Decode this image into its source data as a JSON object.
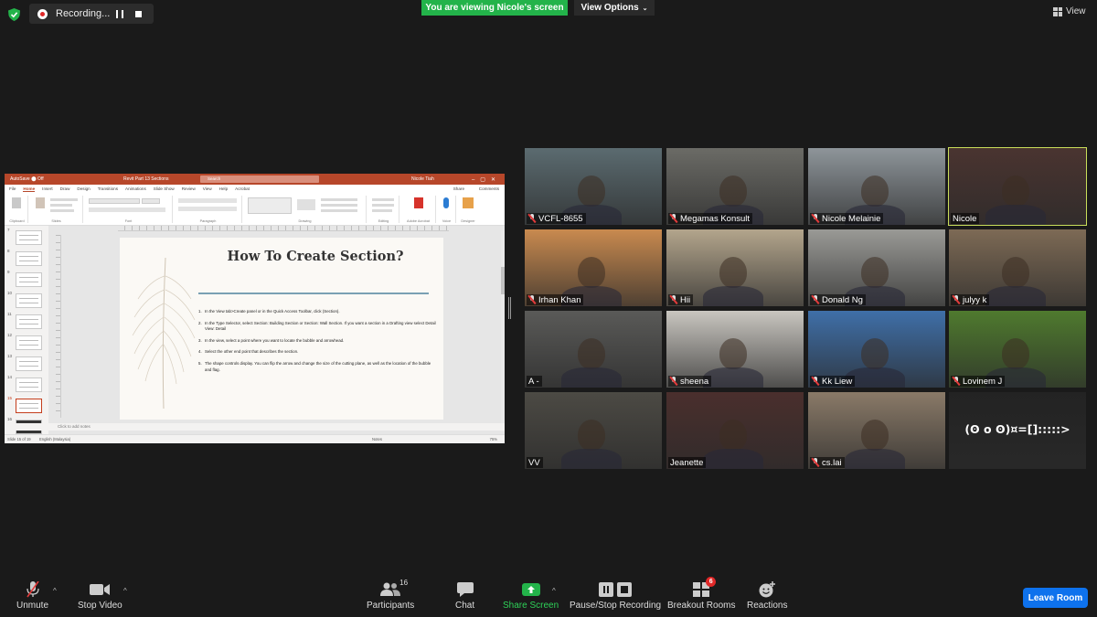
{
  "top_bar": {
    "recording_label": "Recording...",
    "banner_text": "You are viewing Nicole's screen",
    "view_options_label": "View Options",
    "view_label": "View"
  },
  "shared_screen": {
    "ppt": {
      "autosave": "AutoSave ⬤ Off",
      "file_name": "Revit Part 13 Sections",
      "search_placeholder": "Search",
      "user": "Nicole Tiah",
      "tabs": [
        "File",
        "Home",
        "Insert",
        "Draw",
        "Design",
        "Transitions",
        "Animations",
        "Slide Show",
        "Review",
        "View",
        "Help",
        "Acrobat"
      ],
      "share_label": "Share",
      "comments_label": "Comments",
      "ribbon_groups": [
        "Clipboard",
        "Slides",
        "Font",
        "Paragraph",
        "Drawing",
        "Editing",
        "Adobe Acrobat",
        "Voice",
        "Designer"
      ],
      "slide_numbers": [
        "7",
        "8",
        "9",
        "10",
        "11",
        "12",
        "13",
        "14",
        "15",
        "16"
      ],
      "slide_title": "How To Create Section?",
      "slide_items": [
        "In the View tab>Create panel or in the Quick Access Toolbar, click  (Section).",
        "In the Type Selector, select Section: Building Section or Section: Wall Section. If you want a section in a Drafting view select Detail View: Detail",
        "In the view, select a point where you want to locate the bubble and arrowhead.",
        "Select the other end point that describes the section.",
        "The shape controls display. You can flip the arrow and change the size of the cutting plane, as well as the location of the bubble and flag."
      ],
      "notes_placeholder": "Click to add notes",
      "status_slide": "Slide 15 of 19",
      "status_lang": "English (Malaysia)",
      "status_notes": "Notes",
      "status_zoom": "75%"
    }
  },
  "participants_gallery": [
    {
      "name": "VCFL-8655",
      "muted": true,
      "color": "#5b6b70"
    },
    {
      "name": "Megamas Konsult",
      "muted": true,
      "color": "#6b6b66"
    },
    {
      "name": "Nicole Melainie",
      "muted": true,
      "color": "#8e959a"
    },
    {
      "name": "Nicole",
      "muted": false,
      "color": "#4a3430",
      "active_speaker": true
    },
    {
      "name": "Irhan Khan",
      "muted": true,
      "color": "#c98a4f"
    },
    {
      "name": "Hii",
      "muted": true,
      "color": "#b3a58c"
    },
    {
      "name": "Donald Ng",
      "muted": true,
      "color": "#9a9a96"
    },
    {
      "name": "julyy k",
      "muted": true,
      "color": "#7d6a55"
    },
    {
      "name": "A -",
      "muted": false,
      "color": "#5a5a58"
    },
    {
      "name": "sheena",
      "muted": true,
      "color": "#c9c6c0"
    },
    {
      "name": "Kk Liew",
      "muted": true,
      "color": "#3f6fa8"
    },
    {
      "name": "Lovinem J",
      "muted": true,
      "color": "#4f7a2e"
    },
    {
      "name": "VV",
      "muted": false,
      "color": "#4c4a44"
    },
    {
      "name": "Jeanette",
      "muted": false,
      "color": "#4a2f2d"
    },
    {
      "name": "cs.lai",
      "muted": true,
      "color": "#8a7a68"
    },
    {
      "name": "",
      "muted": false,
      "color": "#232323",
      "display_text": "(ʘ o ʘ)¤=[]:::::>"
    }
  ],
  "toolbar": {
    "unmute_label": "Unmute",
    "stop_video_label": "Stop Video",
    "participants_label": "Participants",
    "participants_count": "16",
    "chat_label": "Chat",
    "share_screen_label": "Share Screen",
    "recording_label": "Pause/Stop Recording",
    "breakout_label": "Breakout Rooms",
    "breakout_badge": "6",
    "reactions_label": "Reactions",
    "leave_label": "Leave Room"
  }
}
